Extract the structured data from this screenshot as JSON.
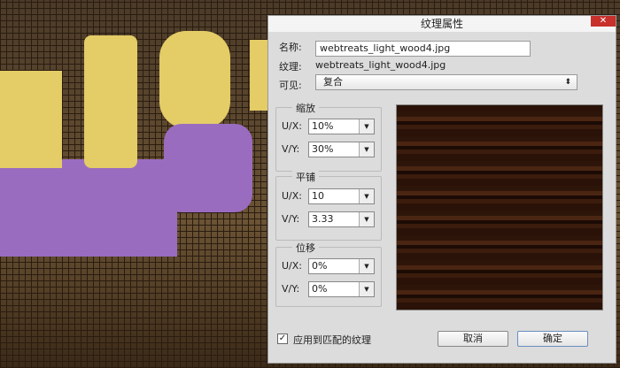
{
  "dialog": {
    "title": "纹理属性",
    "close": "✕",
    "name_label": "名称:",
    "name_value": "webtreats_light_wood4.jpg",
    "texture_label": "纹理:",
    "texture_value": "webtreats_light_wood4.jpg",
    "visible_label": "可见:",
    "visible_value": "复合",
    "scale": {
      "title": "缩放",
      "ux_label": "U/X:",
      "ux": "10%",
      "vy_label": "V/Y:",
      "vy": "30%"
    },
    "tile": {
      "title": "平铺",
      "ux_label": "U/X:",
      "ux": "10",
      "vy_label": "V/Y:",
      "vy": "3.33"
    },
    "offset": {
      "title": "位移",
      "ux_label": "U/X:",
      "ux": "0%",
      "vy_label": "V/Y:",
      "vy": "0%"
    },
    "apply_label": "应用到匹配的纹理",
    "apply_checked": true,
    "cancel": "取消",
    "ok": "确定"
  },
  "colors": {
    "purple": "#9a6cc0",
    "yellow": "#e4cc66",
    "close": "#c8302c"
  }
}
